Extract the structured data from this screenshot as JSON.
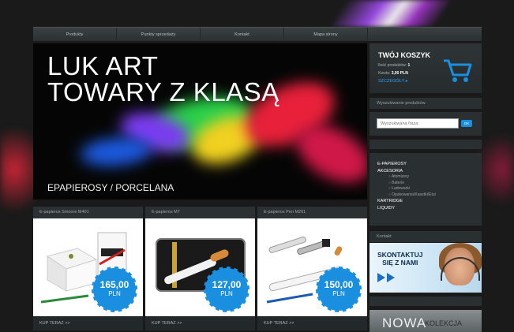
{
  "nav": {
    "items": [
      "Produkty",
      "Punkty sprzedaży",
      "Kontakt",
      "Mapa strony",
      ""
    ]
  },
  "banner": {
    "line1": "LUK ART",
    "line2": "TOWARY Z KLASĄ",
    "subtitle": "EPAPIEROSY / PORCELANA"
  },
  "products": [
    {
      "name": "E-papieros Smoore M401",
      "price": "165,00",
      "currency": "PLN",
      "buy": "KUP TERAZ >>"
    },
    {
      "name": "E-papieros M7",
      "price": "127,00",
      "currency": "PLN",
      "buy": "KUP TERAZ >>"
    },
    {
      "name": "E-papieros Pen M201",
      "price": "150,00",
      "currency": "PLN",
      "buy": "KUP TERAZ >>"
    }
  ],
  "cart": {
    "title": "TWÓJ KOSZYK",
    "count_label": "Ilość produktów:",
    "count_value": "1",
    "total_label": "Kwota:",
    "total_value": "3,00 PLN",
    "details_link": "SZCZEGÓŁY ▸",
    "icon": "shopping-cart-icon"
  },
  "search": {
    "heading": "Wyszukiwanie produktów",
    "placeholder": "Wyszukiwana fraza",
    "button": "OK"
  },
  "categories": {
    "items": [
      {
        "label": "E-PAPIEROSY",
        "level": 0
      },
      {
        "label": "AKCESORIA",
        "level": 0
      },
      {
        "label": "Atomizery",
        "level": 1
      },
      {
        "label": "Baterie",
        "level": 1
      },
      {
        "label": "Ładowarki",
        "level": 1
      },
      {
        "label": "Opakowania/Kasetki/Etui",
        "level": 1
      },
      {
        "label": "KARTRIDGE",
        "level": 0
      },
      {
        "label": "LIQUIDY",
        "level": 0
      }
    ]
  },
  "contact": {
    "heading": "Kontakt",
    "line1": "SKONTAKTUJ",
    "line2": "SIĘ Z NAMI"
  },
  "collection": {
    "big": "NOWA",
    "small": "KOLEKCJA"
  },
  "colors": {
    "accent_blue": "#1a8fe0",
    "background": "#1a1a1a",
    "panel": "#2a2f31"
  }
}
